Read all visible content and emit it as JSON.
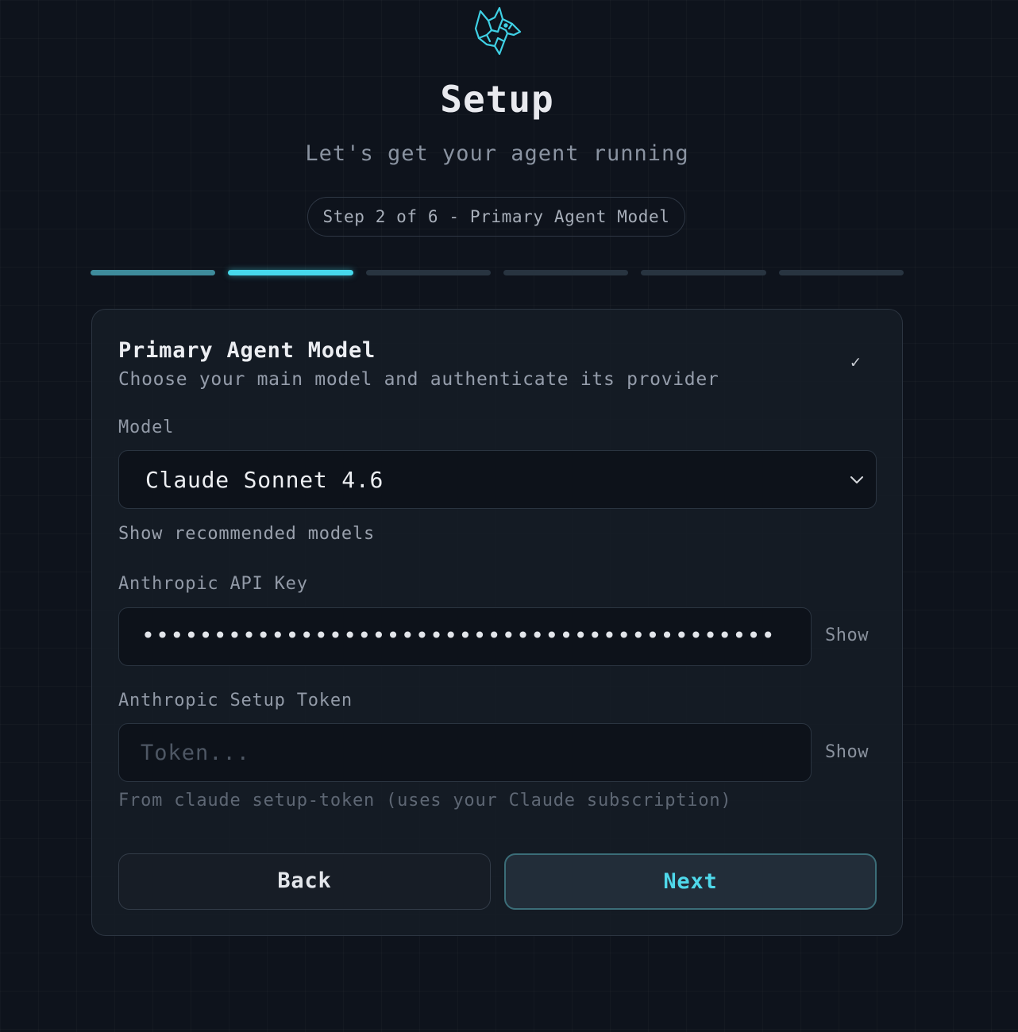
{
  "header": {
    "title": "Setup",
    "subtitle": "Let's get your agent running",
    "step_label": "Step 2 of 6 - Primary Agent Model",
    "logo_icon": "wolf-logo-icon"
  },
  "progress": {
    "current_step": 2,
    "total_steps": 6,
    "colors": {
      "done": "#3e8b9b",
      "active": "#46d9ec",
      "pending": "#283440"
    }
  },
  "card": {
    "title": "Primary Agent Model",
    "description": "Choose your main model and authenticate its provider",
    "status_icon": "check-icon",
    "model": {
      "label": "Model",
      "selected": "Claude Sonnet 4.6"
    },
    "recommended_link": "Show recommended models",
    "api_key": {
      "label": "Anthropic API Key",
      "masked_value": "••••••••••••••••••••••••••••••••••••••••••••",
      "show_label": "Show"
    },
    "setup_token": {
      "label": "Anthropic Setup Token",
      "placeholder": "Token...",
      "show_label": "Show",
      "hint": "From claude setup-token (uses your Claude subscription)"
    },
    "buttons": {
      "back": "Back",
      "next": "Next"
    }
  },
  "theme": {
    "background": "#0e131c",
    "accent": "#46d9ec"
  }
}
